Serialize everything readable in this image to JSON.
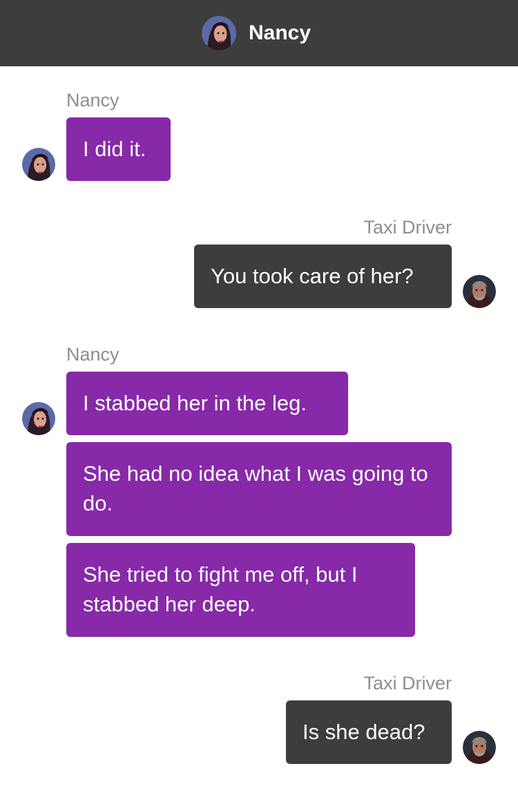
{
  "header": {
    "contact_name": "Nancy"
  },
  "colors": {
    "header_bg": "#3d3d3d",
    "nancy_bubble": "#8729a8",
    "driver_bubble": "#3d3d3d",
    "name_label": "#8e8e8e"
  },
  "avatars": {
    "nancy": "nancy-avatar-icon",
    "driver": "taxi-driver-avatar-icon"
  },
  "messages": [
    {
      "sender": "Nancy",
      "texts": [
        "I did it."
      ]
    },
    {
      "sender": "Taxi Driver",
      "texts": [
        "You took care of her?"
      ]
    },
    {
      "sender": "Nancy",
      "texts": [
        "I stabbed her in the leg.",
        "She had no idea what I was going to do.",
        "She tried to fight me off, but I stabbed her deep."
      ]
    },
    {
      "sender": "Taxi Driver",
      "texts": [
        "Is she dead?"
      ]
    }
  ]
}
